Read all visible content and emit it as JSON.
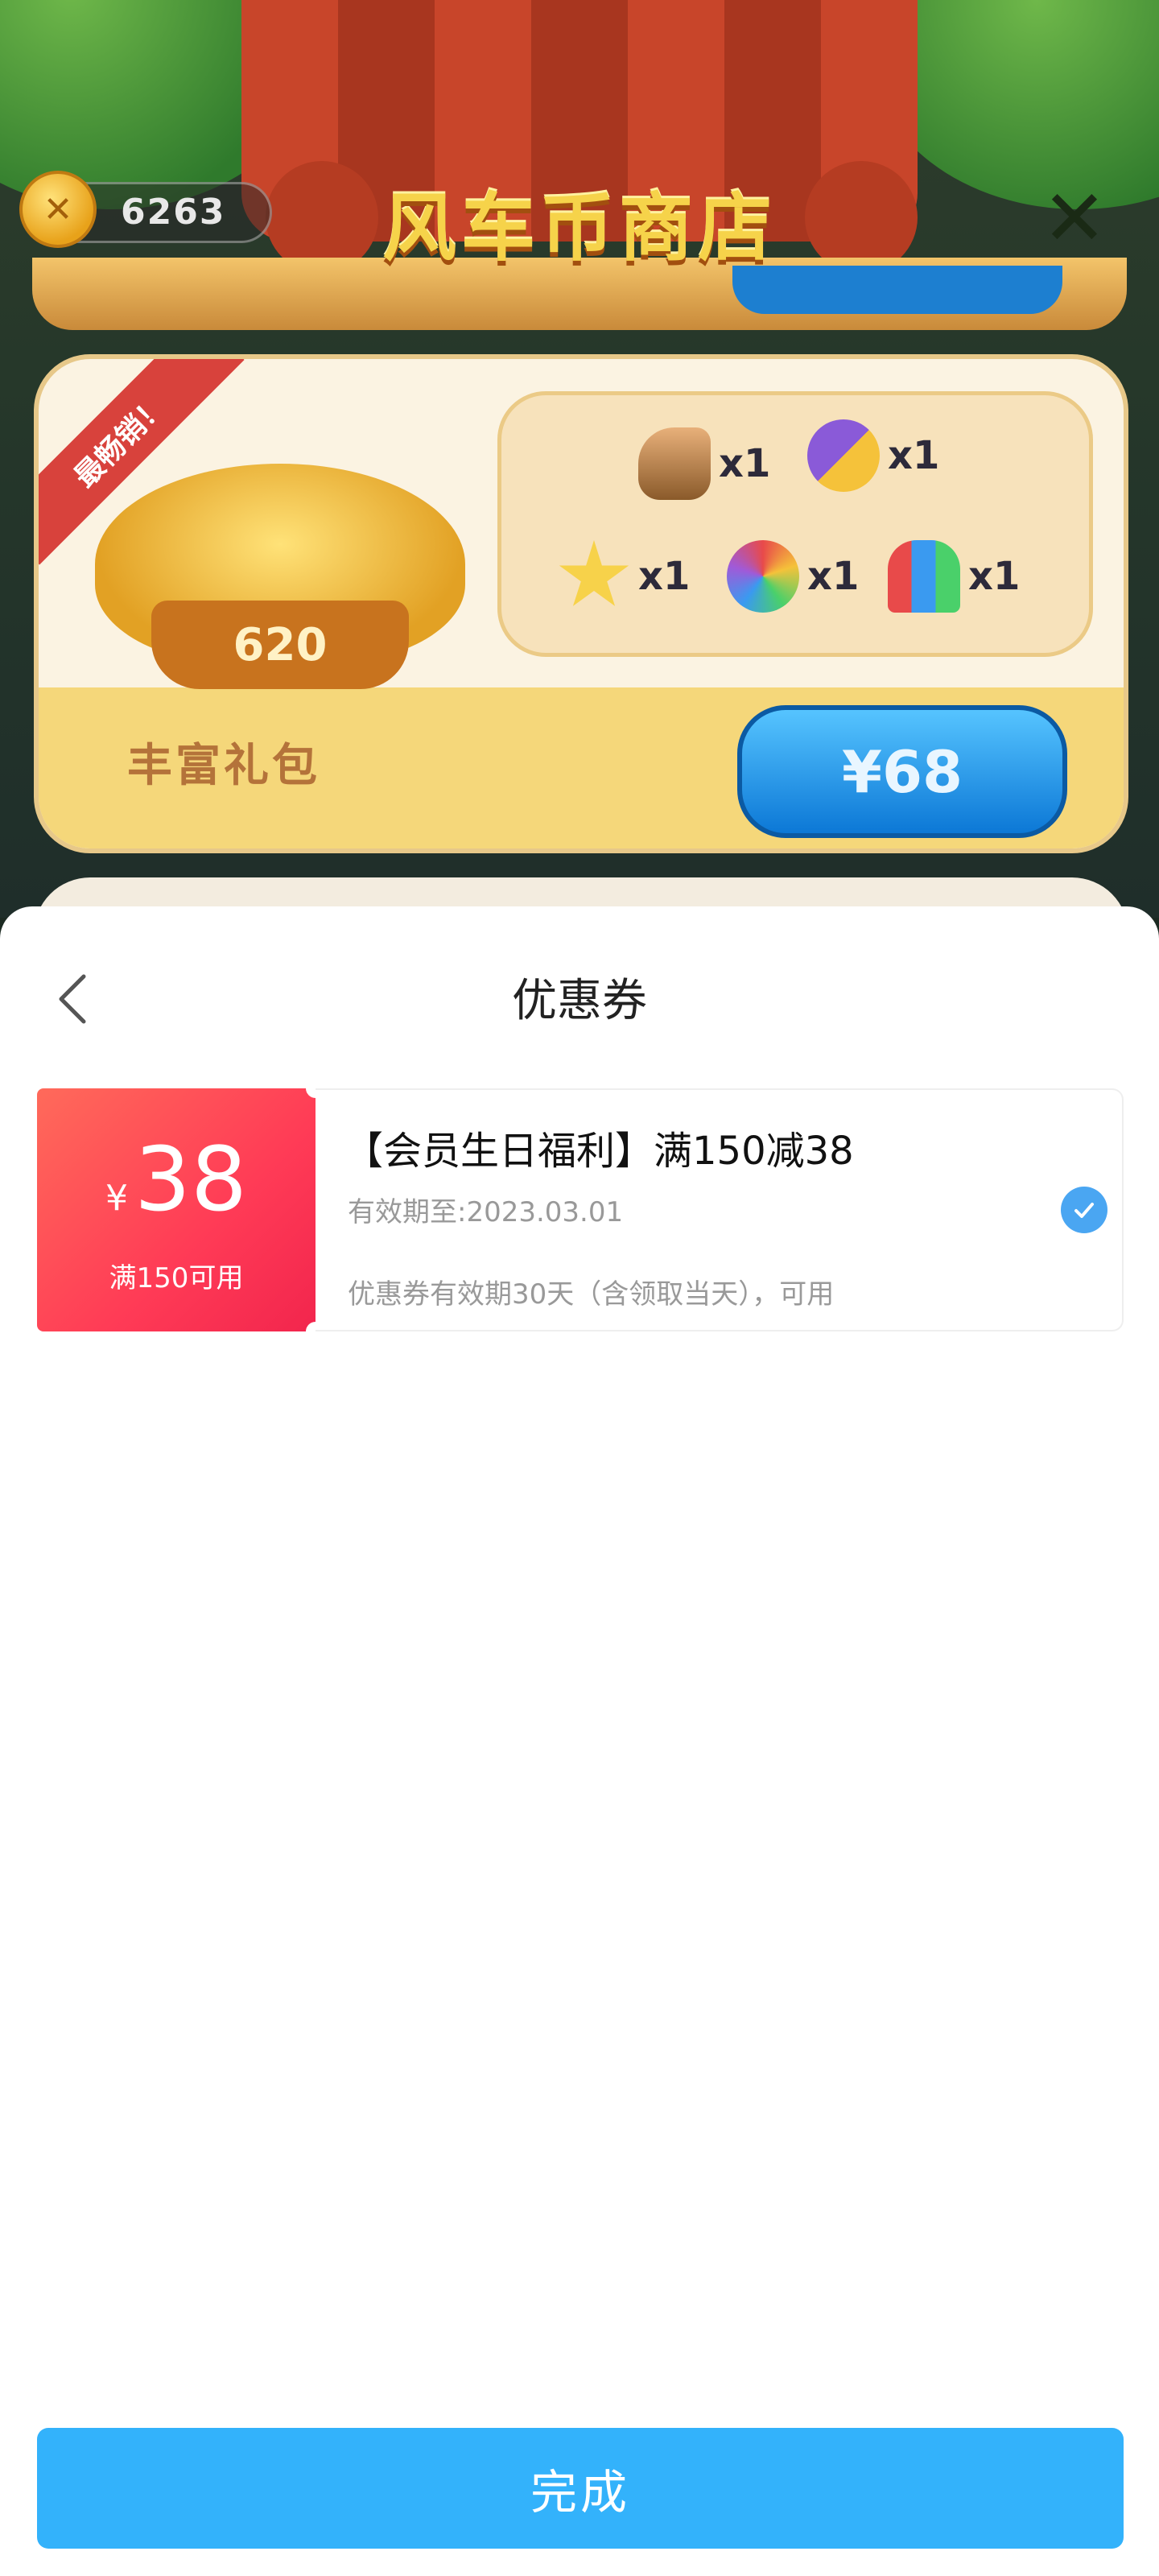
{
  "game": {
    "shop_title": "风车币商店",
    "coin_balance": "6263",
    "close_symbol": "✕",
    "pack": {
      "ribbon": "最畅销！",
      "coin_amount": "620",
      "name": "丰富礼包",
      "price": "¥68",
      "items": [
        {
          "icon": "hammer-icon",
          "qty": "x1"
        },
        {
          "icon": "owl-chick-swap-icon",
          "qty": "x1"
        },
        {
          "icon": "star-wand-icon",
          "qty": "x1"
        },
        {
          "icon": "rainbow-owl-icon",
          "qty": "x1"
        },
        {
          "icon": "rockets-icon",
          "qty": "x1"
        }
      ]
    }
  },
  "sheet": {
    "title": "优惠券",
    "coupon": {
      "currency": "¥",
      "amount": "38",
      "condition": "满150可用",
      "title": "【会员生日福利】满150减38",
      "expiry": "有效期至:2023.03.01",
      "description": "优惠券有效期30天（含领取当天），可用",
      "selected": true
    },
    "done_label": "完成"
  },
  "colors": {
    "coupon_red": "#ff3b56",
    "check_blue": "#4aa6f2",
    "done_blue": "#33b2fb"
  }
}
